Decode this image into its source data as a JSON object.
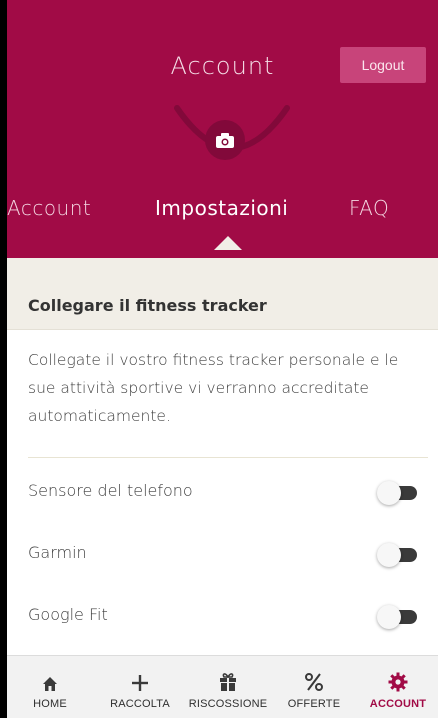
{
  "header": {
    "title": "Account",
    "logout_label": "Logout"
  },
  "tabs": [
    {
      "label": "Account",
      "active": false
    },
    {
      "label": "Impostazioni",
      "active": true
    },
    {
      "label": "FAQ",
      "active": false
    }
  ],
  "section": {
    "title": "Collegare il fitness tracker",
    "description": "Collegate il vostro fitness tracker personale e le sue attività sportive vi verranno accreditate automaticamente."
  },
  "trackers": [
    {
      "label": "Sensore del telefono",
      "enabled": false
    },
    {
      "label": "Garmin",
      "enabled": false
    },
    {
      "label": "Google Fit",
      "enabled": false
    }
  ],
  "bottom_nav": [
    {
      "label": "HOME",
      "icon": "home-icon",
      "active": false
    },
    {
      "label": "RACCOLTA",
      "icon": "plus-icon",
      "active": false
    },
    {
      "label": "RISCOSSIONE",
      "icon": "gift-icon",
      "active": false
    },
    {
      "label": "OFFERTE",
      "icon": "percent-icon",
      "active": false
    },
    {
      "label": "ACCOUNT",
      "icon": "gear-icon",
      "active": true
    }
  ],
  "colors": {
    "brand": "#a10b46",
    "background_section": "#f1eee7",
    "logout_bg": "#c8447a"
  }
}
